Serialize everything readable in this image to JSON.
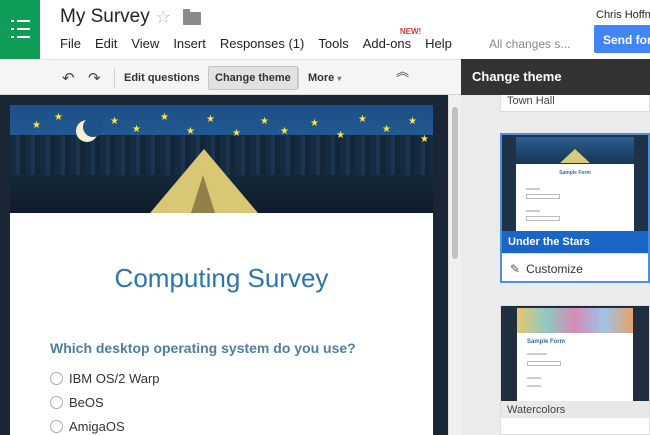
{
  "header": {
    "title": "My Survey",
    "user_name": "Chris Hoffm",
    "send_label": "Send form",
    "saved_status": "All changes s..."
  },
  "menu": {
    "items": [
      "File",
      "Edit",
      "View",
      "Insert",
      "Responses (1)",
      "Tools",
      "Add-ons",
      "Help"
    ],
    "new_badge": "NEW!"
  },
  "toolbar": {
    "edit_questions": "Edit questions",
    "change_theme": "Change theme",
    "more": "More",
    "more_caret": "▾"
  },
  "panel": {
    "title": "Change theme",
    "themes": [
      {
        "name": "Town Hall"
      },
      {
        "name": "Under the Stars",
        "selected": true,
        "thumb_title": "Sample Form"
      },
      {
        "name": "Watercolors",
        "thumb_title": "Sample Form"
      }
    ],
    "customize_label": "Customize"
  },
  "form": {
    "title": "Computing Survey",
    "question": "Which desktop operating system do you use?",
    "options": [
      "IBM OS/2 Warp",
      "BeOS",
      "AmigaOS"
    ]
  },
  "colors": {
    "brand_green": "#0f9d58",
    "send_blue": "#4285f4",
    "selected_theme_blue": "#1a66c7",
    "form_title_blue": "#2a75ad"
  },
  "icons": {
    "star": "☆",
    "undo": "↶",
    "redo": "↷",
    "collapse": "︽",
    "pencil": "✎"
  }
}
